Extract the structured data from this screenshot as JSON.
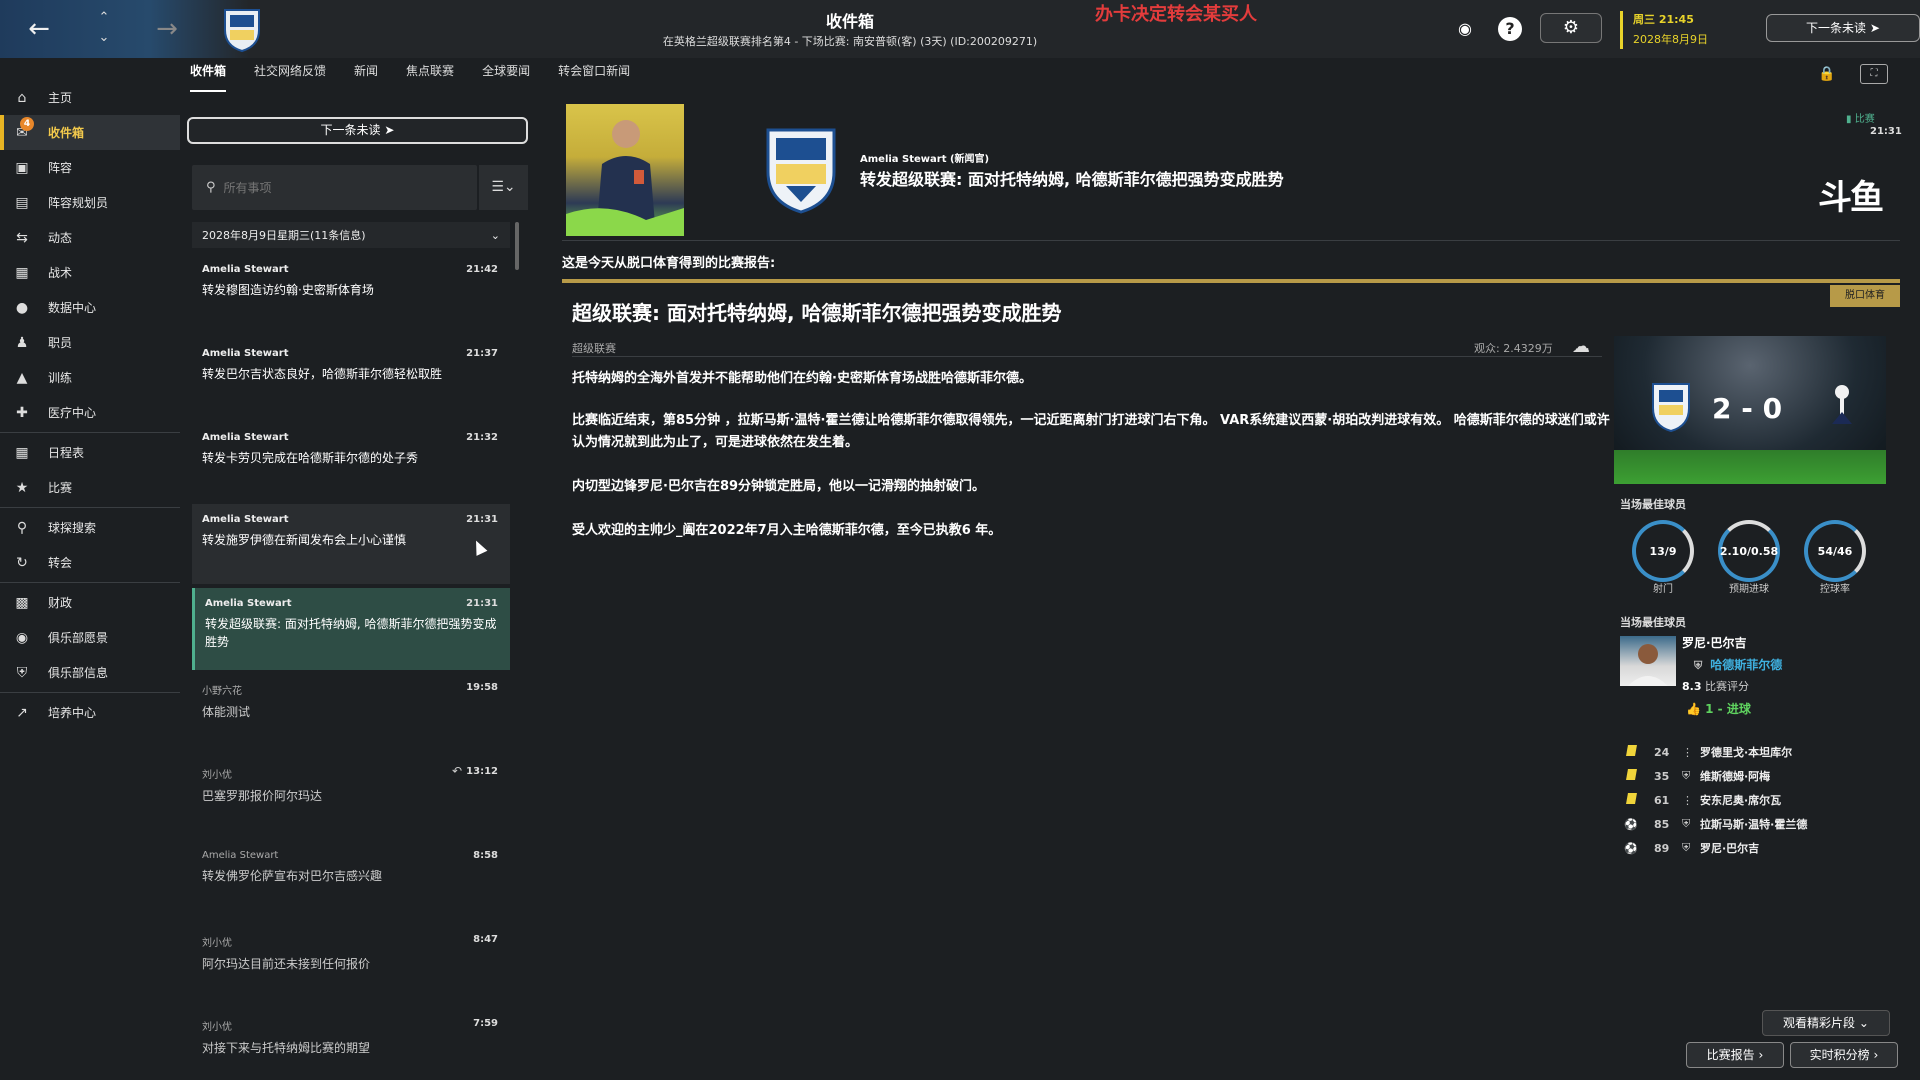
{
  "topbar": {
    "title": "收件箱",
    "subtitle": "在英格兰超级联赛排名第4 - 下场比赛: 南安普顿(客) (3天) (ID:200209271)",
    "overlay_text": "办卡决定转会某买人",
    "date_line1": "周三 21:45",
    "date_line2": "2028年8月9日",
    "next_unread": "下一条未读"
  },
  "sidebar": {
    "items": [
      {
        "label": "主页"
      },
      {
        "label": "收件箱",
        "badge": "4"
      },
      {
        "label": "阵容"
      },
      {
        "label": "阵容规划员"
      },
      {
        "label": "动态"
      },
      {
        "label": "战术"
      },
      {
        "label": "数据中心"
      },
      {
        "label": "职员"
      },
      {
        "label": "训练"
      },
      {
        "label": "医疗中心"
      },
      {
        "label": "日程表"
      },
      {
        "label": "比赛"
      },
      {
        "label": "球探搜索"
      },
      {
        "label": "转会"
      },
      {
        "label": "财政"
      },
      {
        "label": "俱乐部愿景"
      },
      {
        "label": "俱乐部信息"
      },
      {
        "label": "培养中心"
      }
    ]
  },
  "tabs": [
    "收件箱",
    "社交网络反馈",
    "新闻",
    "焦点联赛",
    "全球要闻",
    "转会窗口新闻"
  ],
  "inbox": {
    "next_unread": "下一条未读",
    "search_placeholder": "所有事项",
    "date_group": "2028年8月9日星期三(11条信息)",
    "messages": [
      {
        "sender": "Amelia Stewart",
        "time": "21:42",
        "subject": "转发穆图造访约翰·史密斯体育场"
      },
      {
        "sender": "Amelia Stewart",
        "time": "21:37",
        "subject": "转发巴尔吉状态良好，哈德斯菲尔德轻松取胜"
      },
      {
        "sender": "Amelia Stewart",
        "time": "21:32",
        "subject": "转发卡劳贝完成在哈德斯菲尔德的处子秀"
      },
      {
        "sender": "Amelia Stewart",
        "time": "21:31",
        "subject": "转发施罗伊德在新闻发布会上小心谨慎"
      },
      {
        "sender": "Amelia Stewart",
        "time": "21:31",
        "subject": "转发超级联赛: 面对托特纳姆, 哈德斯菲尔德把强势变成胜势"
      },
      {
        "sender": "小野六花",
        "time": "19:58",
        "subject": "体能测试"
      },
      {
        "sender": "刘小优",
        "time": "13:12",
        "subject": "巴塞罗那报价阿尔玛达"
      },
      {
        "sender": "Amelia Stewart",
        "time": "8:58",
        "subject": "转发佛罗伦萨宣布对巴尔吉感兴趣"
      },
      {
        "sender": "刘小优",
        "time": "8:47",
        "subject": "阿尔玛达目前还未接到任何报价"
      },
      {
        "sender": "刘小优",
        "time": "7:59",
        "subject": "对接下来与托特纳姆比赛的期望"
      }
    ]
  },
  "message": {
    "from": "Amelia Stewart (新闻官)",
    "title": "转发超级联赛: 面对托特纳姆, 哈德斯菲尔德把强势变成胜势",
    "tag": "比赛",
    "tag_time": "21:31",
    "douyu": "斗鱼",
    "intro": "这是今天从脱口体育得到的比赛报告:",
    "source": "脱口体育",
    "article_title": "超级联赛: 面对托特纳姆, 哈德斯菲尔德把强势变成胜势",
    "league": "超级联赛",
    "attendance": "观众: 2.4329万",
    "paragraphs": [
      "托特纳姆的全海外首发并不能帮助他们在约翰·史密斯体育场战胜哈德斯菲尔德。",
      "比赛临近结束，第85分钟 ，拉斯马斯·温特·霍兰德让哈德斯菲尔德取得领先，一记近距离射门打进球门右下角。 VAR系统建议西蒙·胡珀改判进球有效。 哈德斯菲尔德的球迷们或许认为情况就到此为止了，可是进球依然在发生着。",
      "内切型边锋罗尼·巴尔吉在89分钟锁定胜局，他以一记滑翔的抽射破门。",
      "受人欢迎的主帅少_阖在2022年7月入主哈德斯菲尔德，至今已执教6 年。"
    ]
  },
  "match": {
    "score": "2 - 0",
    "stats_heading": "当场最佳球员",
    "stats": [
      {
        "value": "13/9",
        "label": "射门"
      },
      {
        "value": "2.10/0.58",
        "label": "预期进球"
      },
      {
        "value": "54/46",
        "label": "控球率"
      }
    ],
    "motm_heading": "当场最佳球员",
    "motm_name": "罗尼·巴尔吉",
    "motm_team": "哈德斯菲尔德",
    "motm_rating_value": "8.3",
    "motm_rating_label": "比赛评分",
    "motm_goals": "1 - 进球",
    "events": [
      {
        "type": "yellow",
        "minute": "24",
        "name": "罗德里戈·本坦库尔"
      },
      {
        "type": "yellow",
        "minute": "35",
        "name": "维斯德姆·阿梅"
      },
      {
        "type": "yellow",
        "minute": "61",
        "name": "安东尼奥·席尔瓦"
      },
      {
        "type": "goal",
        "minute": "85",
        "name": "拉斯马斯·温特·霍兰德"
      },
      {
        "type": "goal",
        "minute": "89",
        "name": "罗尼·巴尔吉"
      }
    ],
    "highlights": "观看精彩片段",
    "report_btn": "比赛报告",
    "live_table_btn": "实时积分榜"
  },
  "colors": {
    "accent": "#e8b524",
    "selected": "#2e4d45",
    "gold": "#b79a48",
    "team_blue": "#3fb1e0"
  }
}
